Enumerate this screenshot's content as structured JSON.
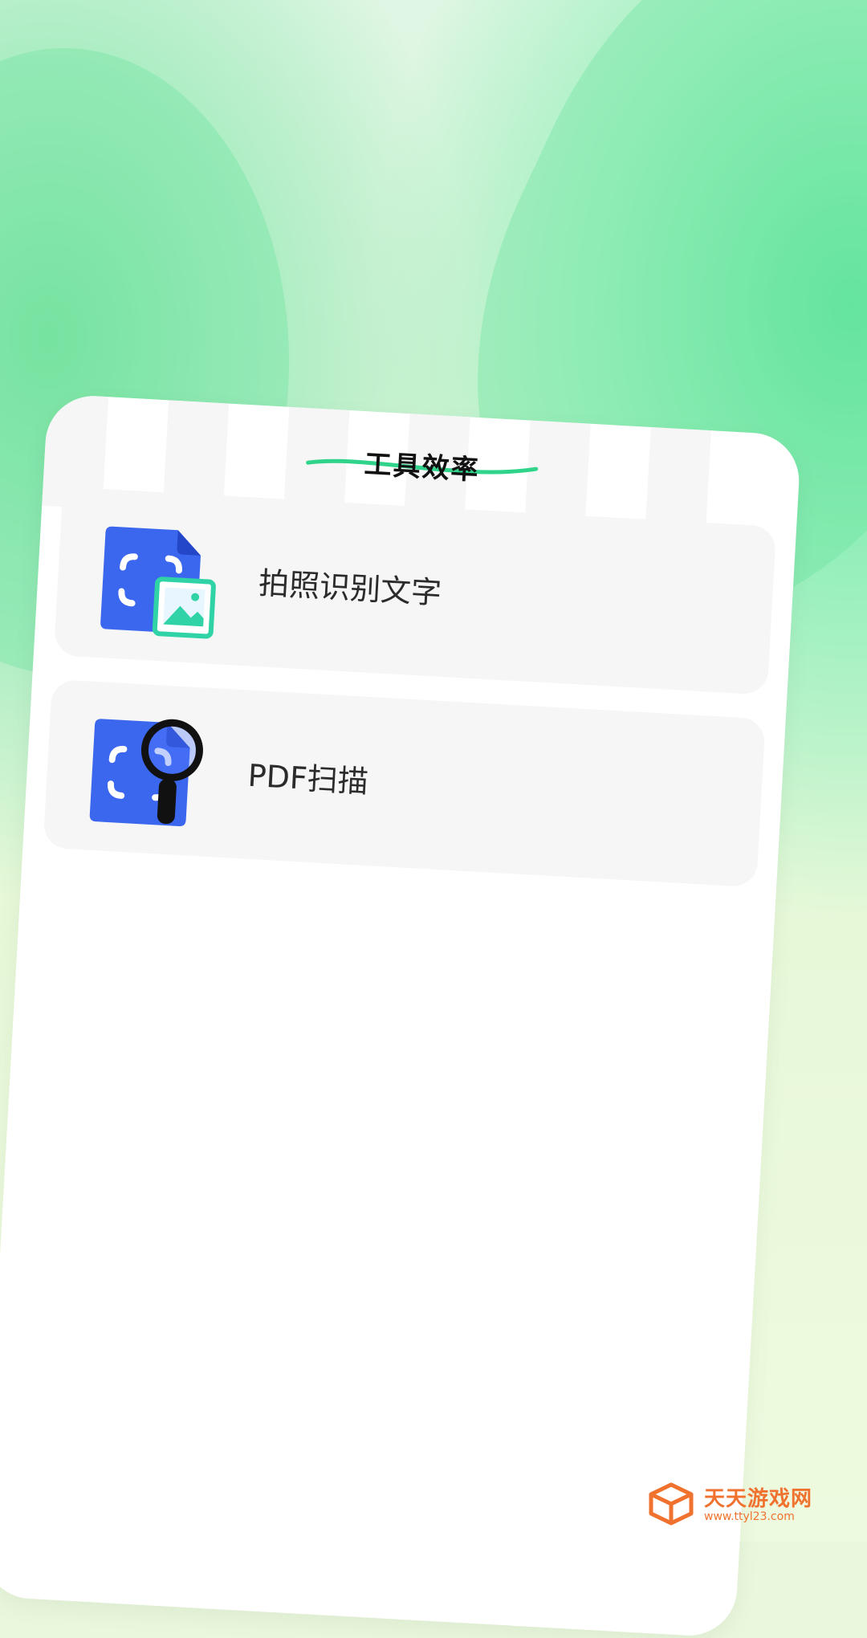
{
  "card": {
    "title": "工具效率"
  },
  "tools": [
    {
      "label": "拍照识别文字",
      "icon": "photo-ocr-icon"
    },
    {
      "label": "PDF扫描",
      "icon": "pdf-scan-icon"
    }
  ],
  "watermark": {
    "name": "天天游戏网",
    "url": "www.ttyl23.com",
    "icon": "cube-logo-icon"
  },
  "colors": {
    "accent_green": "#2fd48a",
    "icon_blue": "#3b67ee",
    "icon_teal": "#2fd3a6",
    "watermark_orange": "#f0722f"
  }
}
